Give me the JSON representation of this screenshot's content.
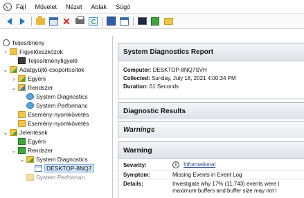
{
  "menu": {
    "items": [
      "Fájl",
      "Művelet",
      "Nézet",
      "Ablak",
      "Súgó"
    ]
  },
  "toolbar": {
    "icons": [
      "back-arrow-icon",
      "forward-arrow-icon",
      "up-folder-icon",
      "console-tree-icon",
      "delete-icon",
      "print-icon",
      "refresh-icon",
      "properties-icon",
      "view-icon",
      "monitor-icon",
      "start-icon",
      "folder-icon"
    ]
  },
  "tree": {
    "root": "Teljesítmény",
    "monitoring_tools": "Figyelőeszközok",
    "performance_monitor": "Teljesítményfigyelő",
    "data_collector_sets": "Adatgyűjtő-csoportosítók",
    "user_defined": "Egyéni",
    "system": "Rendszer",
    "system_diagnostics": "System Diagnostics",
    "system_performance": "System Performanc",
    "event_trace_1": "Esemény-nyomkövetés",
    "event_trace_2": "Esemény-nyomkövetés",
    "reports": "Jelentések",
    "reports_user_defined": "Egyéni",
    "reports_system": "Rendszer",
    "reports_system_diagnostics": "System Diagnostics",
    "report_item": "DESKTOP-8NQ7",
    "reports_system_performance": "System Performan"
  },
  "report": {
    "title": "System Diagnostics Report",
    "computer_label": "Computer:",
    "computer_value": "DESKTOP-8NQ7SVH",
    "collected_label": "Collected:",
    "collected_value": "Sunday, July 18, 2021 4:00:34 PM",
    "duration_label": "Duration:",
    "duration_value": "61 Seconds",
    "diagnostic_results": "Diagnostic Results",
    "warnings": "Warnings",
    "warning": "Warning",
    "severity_label": "Severity:",
    "severity_value": "Informational",
    "symptom_label": "Symptom:",
    "symptom_value": "Missing Events in Event Log",
    "details_label": "Details:",
    "details_line1": "Investigate why 17% (11,743) events were l",
    "details_line2": "maximum buffers and buffer size may not l"
  }
}
